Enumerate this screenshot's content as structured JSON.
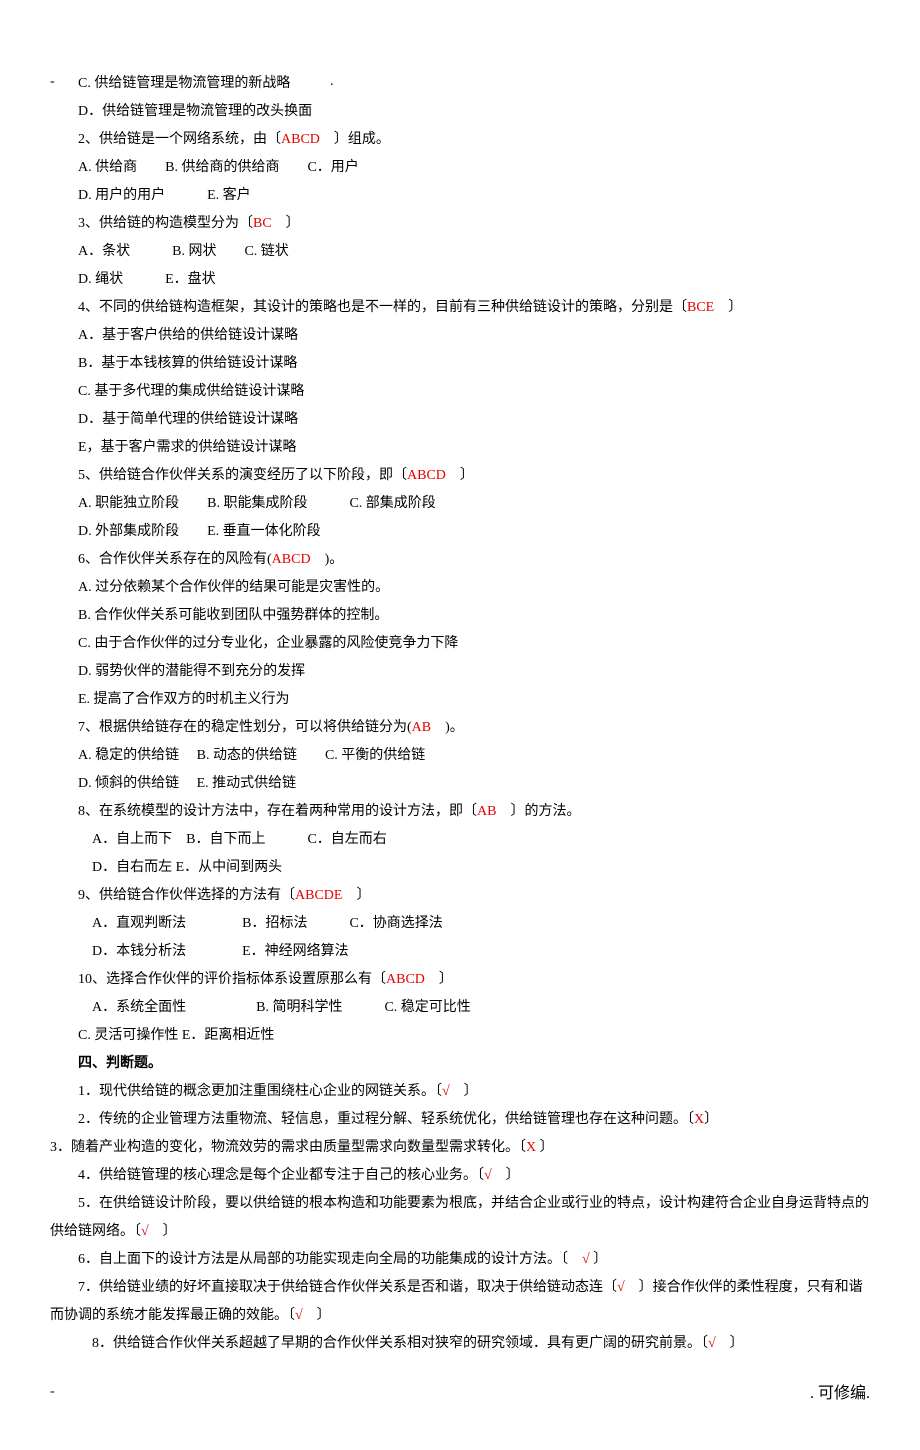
{
  "header": {
    "dash": "-",
    "dot": "."
  },
  "lines": [
    {
      "cls": "indent",
      "segs": [
        {
          "t": "C. 供给链管理是物流管理的新战略"
        }
      ]
    },
    {
      "cls": "indent",
      "segs": [
        {
          "t": "D．供给链管理是物流管理的改头换面"
        }
      ]
    },
    {
      "cls": "indent",
      "segs": [
        {
          "t": "2、供给链是一个网络系统，由〔"
        },
        {
          "t": "ABCD",
          "a": true
        },
        {
          "t": "　〕组成。"
        }
      ]
    },
    {
      "cls": "indent",
      "segs": [
        {
          "t": "A. 供给商　　B. 供给商的供给商　　C．用户"
        }
      ]
    },
    {
      "cls": "indent",
      "segs": [
        {
          "t": "D. 用户的用户　　　E. 客户"
        }
      ]
    },
    {
      "cls": "indent",
      "segs": [
        {
          "t": "3、供给链的构造模型分为〔"
        },
        {
          "t": "BC",
          "a": true
        },
        {
          "t": "　〕"
        }
      ]
    },
    {
      "cls": "indent",
      "segs": [
        {
          "t": "A．条状　　　B. 网状　　C. 链状"
        }
      ]
    },
    {
      "cls": "indent",
      "segs": [
        {
          "t": "D. 绳状　　　E．盘状"
        }
      ]
    },
    {
      "cls": "indent",
      "segs": [
        {
          "t": "4、不同的供给链构造框架，其设计的策略也是不一样的，目前有三种供给链设计的策略，分别是〔"
        },
        {
          "t": "BCE",
          "a": true
        },
        {
          "t": "　〕"
        }
      ]
    },
    {
      "cls": "indent",
      "segs": [
        {
          "t": "A．基于客户供给的供给链设计谋略"
        }
      ]
    },
    {
      "cls": "indent",
      "segs": [
        {
          "t": "B．基于本钱核算的供给链设计谋略"
        }
      ]
    },
    {
      "cls": "indent",
      "segs": [
        {
          "t": "C. 基于多代理的集成供给链设计谋略"
        }
      ]
    },
    {
      "cls": "indent",
      "segs": [
        {
          "t": "D．基于简单代理的供给链设计谋略"
        }
      ]
    },
    {
      "cls": "indent",
      "segs": [
        {
          "t": "E，基于客户需求的供给链设计谋略"
        }
      ]
    },
    {
      "cls": "indent",
      "segs": [
        {
          "t": "5、供给链合作伙伴关系的演变经历了以下阶段，即〔"
        },
        {
          "t": "ABCD",
          "a": true
        },
        {
          "t": "　〕"
        }
      ]
    },
    {
      "cls": "indent",
      "segs": [
        {
          "t": "A. 职能独立阶段　　B. 职能集成阶段　　　C. 部集成阶段"
        }
      ]
    },
    {
      "cls": "indent",
      "segs": [
        {
          "t": "D. 外部集成阶段　　E. 垂直一体化阶段"
        }
      ]
    },
    {
      "cls": "indent",
      "segs": [
        {
          "t": "6、合作伙伴关系存在的风险有("
        },
        {
          "t": "ABCD",
          "a": true
        },
        {
          "t": "　)。"
        }
      ]
    },
    {
      "cls": "indent",
      "segs": [
        {
          "t": "A. 过分依赖某个合作伙伴的结果可能是灾害性的。"
        }
      ]
    },
    {
      "cls": "indent",
      "segs": [
        {
          "t": "B. 合作伙伴关系可能收到团队中强势群体的控制。"
        }
      ]
    },
    {
      "cls": "indent",
      "segs": [
        {
          "t": "C. 由于合作伙伴的过分专业化，企业暴露的风险使竞争力下降"
        }
      ]
    },
    {
      "cls": "indent",
      "segs": [
        {
          "t": "D. 弱势伙伴的潜能得不到充分的发挥"
        }
      ]
    },
    {
      "cls": "indent",
      "segs": [
        {
          "t": "E. 提高了合作双方的时机主义行为"
        }
      ]
    },
    {
      "cls": "indent",
      "segs": [
        {
          "t": "7、根据供给链存在的稳定性划分，可以将供给链分为("
        },
        {
          "t": "AB",
          "a": true
        },
        {
          "t": "　)。"
        }
      ]
    },
    {
      "cls": "indent",
      "segs": [
        {
          "t": "A. 稳定的供给链　 B. 动态的供给链　　C. 平衡的供给链"
        }
      ]
    },
    {
      "cls": "indent",
      "segs": [
        {
          "t": "D. 倾斜的供给链　 E. 推动式供给链"
        }
      ]
    },
    {
      "cls": "indent",
      "segs": [
        {
          "t": "8、在系统模型的设计方法中，存在着两种常用的设计方法，即〔"
        },
        {
          "t": "AB",
          "a": true
        },
        {
          "t": "　〕的方法。"
        }
      ]
    },
    {
      "cls": "indent-more",
      "segs": [
        {
          "t": "A．自上而下　B．自下而上　　　C．自左而右"
        }
      ]
    },
    {
      "cls": "indent-more",
      "segs": [
        {
          "t": "D．自右而左 E．从中间到两头"
        }
      ]
    },
    {
      "cls": "indent",
      "segs": [
        {
          "t": "9、供给链合作伙伴选择的方法有〔"
        },
        {
          "t": "ABCDE",
          "a": true
        },
        {
          "t": "　〕"
        }
      ]
    },
    {
      "cls": "indent-more",
      "segs": [
        {
          "t": "A．直观判断法　　　　B．招标法　　　C．协商选择法"
        }
      ]
    },
    {
      "cls": "indent-more",
      "segs": [
        {
          "t": "D．本钱分析法　　　　E．神经网络算法"
        }
      ]
    },
    {
      "cls": "indent",
      "segs": [
        {
          "t": "10、选择合作伙伴的评价指标体系设置原那么有〔"
        },
        {
          "t": "ABCD",
          "a": true
        },
        {
          "t": "　〕"
        }
      ]
    },
    {
      "cls": "indent-more",
      "segs": [
        {
          "t": "A．系统全面性　　　　　B. 简明科学性　　　C. 稳定可比性"
        }
      ]
    },
    {
      "cls": "indent",
      "segs": [
        {
          "t": "C. 灵活可操作性 E．距离相近性"
        }
      ]
    },
    {
      "cls": "indent bold",
      "segs": [
        {
          "t": "四、判断题。"
        }
      ]
    },
    {
      "cls": "indent",
      "segs": [
        {
          "t": "1．现代供给链的概念更加注重围绕柱心企业的网链关系。〔"
        },
        {
          "t": "√",
          "a": true
        },
        {
          "t": "　〕"
        }
      ]
    },
    {
      "cls": "indent",
      "segs": [
        {
          "t": "2．传统的企业管理方法重物流、轻信息，重过程分解、轻系统优化，供给链管理也存在这种问题。〔"
        },
        {
          "t": "X",
          "a": true
        },
        {
          "t": "〕"
        }
      ]
    },
    {
      "cls": "",
      "segs": [
        {
          "t": "3．随着产业构造的变化，物流效劳的需求由质量型需求向数量型需求转化。〔"
        },
        {
          "t": "X",
          "a": true
        },
        {
          "t": " 〕"
        }
      ]
    },
    {
      "cls": "indent",
      "segs": [
        {
          "t": "4．供给链管理的核心理念是每个企业都专注于自己的核心业务。〔"
        },
        {
          "t": "√",
          "a": true
        },
        {
          "t": "　〕"
        }
      ]
    },
    {
      "cls": "indent",
      "segs": [
        {
          "t": "5．在供给链设计阶段，要以供给链的根本构造和功能要素为根底，并结合企业或行业的特点，设计构建符合企业自身运背特点的供给链网络。〔"
        },
        {
          "t": "√",
          "a": true
        },
        {
          "t": "　〕"
        }
      ]
    },
    {
      "cls": "indent",
      "segs": [
        {
          "t": "6．自上面下的设计方法是从局部的功能实现走向全局的功能集成的设计方法。〔　"
        },
        {
          "t": "√",
          "a": true
        },
        {
          "t": " 〕"
        }
      ]
    },
    {
      "cls": "indent",
      "segs": [
        {
          "t": "7．供给链业绩的好坏直接取决于供给链合作伙伴关系是否和谐，取决于供给链动态连〔"
        },
        {
          "t": "√",
          "a": true
        },
        {
          "t": "　〕接合作伙伴的柔性程度，只有和谐而协调的系统才能发挥最正确的效能。〔"
        },
        {
          "t": "√",
          "a": true
        },
        {
          "t": "　〕"
        }
      ]
    },
    {
      "cls": "indent",
      "segs": [
        {
          "t": "　8．供给链合作伙伴关系超越了早期的合作伙伴关系相对狭窄的研究领域．具有更广阔的研究前景。〔"
        },
        {
          "t": "√",
          "a": true
        },
        {
          "t": "　〕"
        }
      ]
    }
  ],
  "footer": {
    "left": "-",
    "right": ". 可修编."
  }
}
